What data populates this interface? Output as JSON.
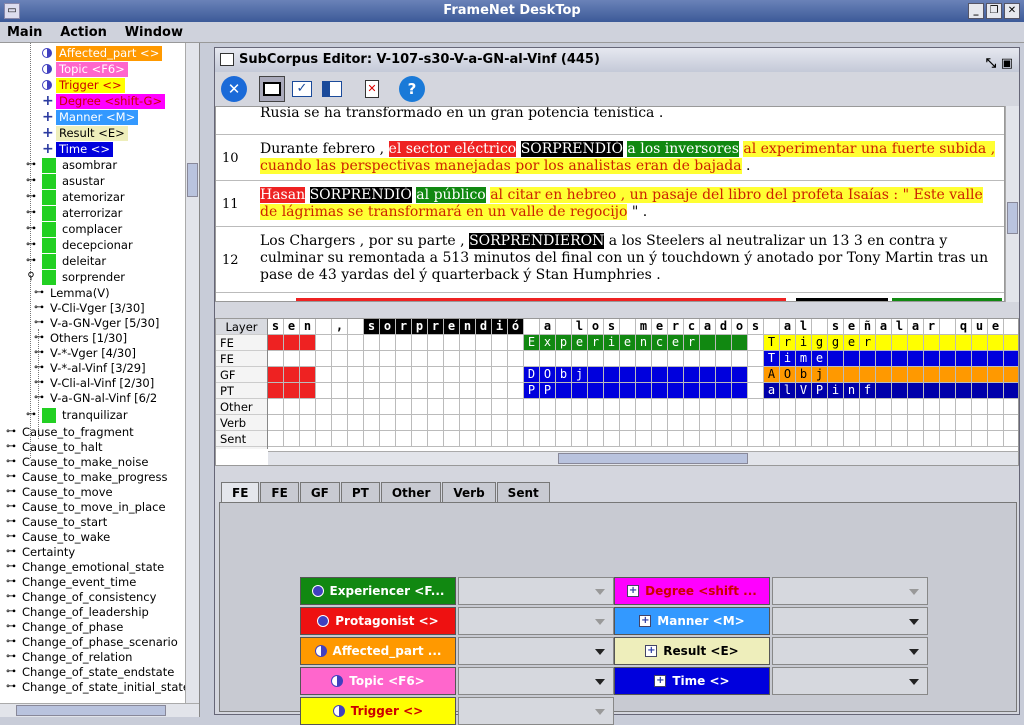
{
  "window": {
    "title": "FrameNet DeskTop"
  },
  "menu": [
    "Main",
    "Action",
    "Window"
  ],
  "tree": {
    "fe_items": [
      {
        "label": "Affected_part <>",
        "bg": "#ff9900",
        "fg": "#fff",
        "icon": "half"
      },
      {
        "label": "Topic <F6>",
        "bg": "#ff66cc",
        "fg": "#fff",
        "icon": "half"
      },
      {
        "label": "Trigger <>",
        "bg": "#ffff00",
        "fg": "#cc0000",
        "icon": "half"
      },
      {
        "label": "Degree <shift-G>",
        "bg": "#ff00ff",
        "fg": "#cc0000",
        "icon": "cross"
      },
      {
        "label": "Manner <M>",
        "bg": "#3399ff",
        "fg": "#fff",
        "icon": "cross"
      },
      {
        "label": "Result <E>",
        "bg": "#eeeebb",
        "fg": "#000",
        "icon": "cross"
      },
      {
        "label": "Time <>",
        "bg": "#0000dd",
        "fg": "#fff",
        "icon": "cross"
      }
    ],
    "lus": [
      "asombrar",
      "asustar",
      "atemorizar",
      "aterrorizar",
      "complacer",
      "decepcionar",
      "deleitar",
      "sorprender"
    ],
    "subcorpora": [
      "Lemma(V)",
      "V-Cli-Vger [3/30]",
      "V-a-GN-Vger [5/30]",
      "Others [1/30]",
      "V-*-Vger [4/30]",
      "V-*-al-Vinf [3/29]",
      "V-Cli-al-Vinf [2/30]",
      "V-a-GN-al-Vinf [6/2"
    ],
    "last_lu": "tranquilizar",
    "frames": [
      "Cause_to_fragment",
      "Cause_to_halt",
      "Cause_to_make_noise",
      "Cause_to_make_progress",
      "Cause_to_move",
      "Cause_to_move_in_place",
      "Cause_to_start",
      "Cause_to_wake",
      "Certainty",
      "Change_emotional_state",
      "Change_event_time",
      "Change_of_consistency",
      "Change_of_leadership",
      "Change_of_phase",
      "Change_of_phase_scenario",
      "Change_of_relation",
      "Change_of_state_endstate",
      "Change_of_state_initial_state"
    ]
  },
  "editor": {
    "title": "SubCorpus Editor: V-107-s30-V-a-GN-al-Vinf (445)",
    "sentences": [
      {
        "num": "",
        "segments": [
          {
            "t": "Rusia se ha transformado en un gran potencia tenística .",
            "c": ""
          }
        ]
      },
      {
        "num": "10",
        "segments": [
          {
            "t": "Durante febrero , ",
            "c": ""
          },
          {
            "t": "el sector eléctrico",
            "c": "hl-red"
          },
          {
            "t": " ",
            "c": ""
          },
          {
            "t": "SORPRENDIÓ",
            "c": "hl-blk"
          },
          {
            "t": " ",
            "c": ""
          },
          {
            "t": "a los inversores",
            "c": "hl-grn"
          },
          {
            "t": " ",
            "c": ""
          },
          {
            "t": "al experimentar una fuerte subida , cuando las perspectivas manejadas por los analistas eran de bajada",
            "c": "hl-yel"
          },
          {
            "t": " .",
            "c": ""
          }
        ]
      },
      {
        "num": "11",
        "segments": [
          {
            "t": "Hasan",
            "c": "hl-red"
          },
          {
            "t": " ",
            "c": ""
          },
          {
            "t": "SORPRENDIÓ",
            "c": "hl-blk"
          },
          {
            "t": " ",
            "c": ""
          },
          {
            "t": "al público",
            "c": "hl-grn"
          },
          {
            "t": " ",
            "c": ""
          },
          {
            "t": "al citar en hebreo , un pasaje del libro del profeta Isaías : \" Este valle de lágrimas se transformará en un valle de regocijo",
            "c": "hl-yel"
          },
          {
            "t": " \" .",
            "c": ""
          }
        ]
      },
      {
        "num": "12",
        "segments": [
          {
            "t": "Los Chargers , por su parte , ",
            "c": ""
          },
          {
            "t": "SORPRENDIERON",
            "c": "hl-blk"
          },
          {
            "t": " a los Steelers al neutralizar un 13 3 en contra y culminar su remontada a 513 minutos del final con un ý touchdown ý anotado por Tony Martin tras un pase de 43 yardas del ý quarterback ý Stan Humphries .",
            "c": ""
          }
        ]
      }
    ],
    "layers": [
      "Layer",
      "FE",
      "FE",
      "GF",
      "PT",
      "Other",
      "Verb",
      "Sent"
    ],
    "tokens": [
      "s",
      "e",
      "n",
      " ",
      ",",
      " ",
      "s",
      "o",
      "r",
      "p",
      "r",
      "e",
      "n",
      "d",
      "i",
      "ó",
      " ",
      "a",
      " ",
      "l",
      "o",
      "s",
      " ",
      "m",
      "e",
      "r",
      "c",
      "a",
      "d",
      "o",
      "s",
      " ",
      "a",
      "l",
      " ",
      "s",
      "e",
      "ñ",
      "a",
      "l",
      "a",
      "r",
      " ",
      "q",
      "u",
      "e",
      " ",
      "c",
      "a"
    ],
    "tabs": [
      "FE",
      "FE",
      "GF",
      "PT",
      "Other",
      "Verb",
      "Sent"
    ],
    "fe_buttons": [
      {
        "label": "Experiencer <F...",
        "bg": "#118811",
        "fg": "#fff",
        "icon": "dot"
      },
      {
        "label": "Protagonist <>",
        "bg": "#ee1111",
        "fg": "#fff",
        "icon": "dot"
      },
      {
        "label": "Affected_part ...",
        "bg": "#ff9900",
        "fg": "#fff",
        "icon": "half"
      },
      {
        "label": "Topic <F6>",
        "bg": "#ff66cc",
        "fg": "#fff",
        "icon": "half"
      },
      {
        "label": "Trigger <>",
        "bg": "#ffff00",
        "fg": "#cc0000",
        "icon": "half"
      },
      {
        "label": "Degree <shift ...",
        "bg": "#ff00ff",
        "fg": "#cc0000",
        "icon": "cross"
      },
      {
        "label": "Manner <M>",
        "bg": "#3399ff",
        "fg": "#fff",
        "icon": "cross"
      },
      {
        "label": "Result <E>",
        "bg": "#eeeebb",
        "fg": "#000",
        "icon": "cross"
      },
      {
        "label": "Time <>",
        "bg": "#0000dd",
        "fg": "#fff",
        "icon": "cross"
      }
    ],
    "grid_labels": {
      "experiencer": "Experiencer",
      "trigger": "Trigger",
      "time": "Time",
      "dobj": "DObj",
      "aobj": "AObj",
      "pp": "PP",
      "alvpinf": "alVPinf"
    }
  }
}
